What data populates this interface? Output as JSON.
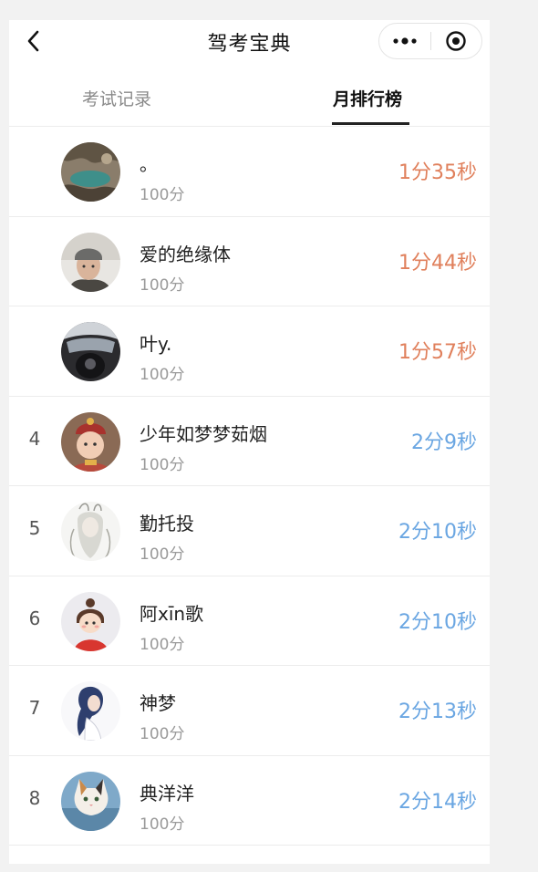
{
  "header": {
    "title": "驾考宝典"
  },
  "tabs": [
    {
      "label": "考试记录",
      "active": false
    },
    {
      "label": "月排行榜",
      "active": true
    }
  ],
  "colors": {
    "top_time": "#e0805c",
    "normal_time": "#6aa6e2"
  },
  "ranking": [
    {
      "rank": "",
      "name": "。",
      "score": "100分",
      "time": "1分35秒",
      "avatar": "avatar-cave-icon"
    },
    {
      "rank": "",
      "name": "爱的绝缘体",
      "score": "100分",
      "time": "1分44秒",
      "avatar": "avatar-man-beanie-icon"
    },
    {
      "rank": "",
      "name": "叶y.",
      "score": "100分",
      "time": "1分57秒",
      "avatar": "avatar-car-interior-icon"
    },
    {
      "rank": "4",
      "name": "少年如梦梦茹烟",
      "score": "100分",
      "time": "2分9秒",
      "avatar": "avatar-child-costume-icon"
    },
    {
      "rank": "5",
      "name": "勤托投",
      "score": "100分",
      "time": "2分10秒",
      "avatar": "avatar-sketch-girl-icon"
    },
    {
      "rank": "6",
      "name": "阿xīn歌",
      "score": "100分",
      "time": "2分10秒",
      "avatar": "avatar-cartoon-girl-icon"
    },
    {
      "rank": "7",
      "name": "神梦",
      "score": "100分",
      "time": "2分13秒",
      "avatar": "avatar-illustration-girl-icon"
    },
    {
      "rank": "8",
      "name": "典洋洋",
      "score": "100分",
      "time": "2分14秒",
      "avatar": "avatar-cat-icon"
    }
  ]
}
